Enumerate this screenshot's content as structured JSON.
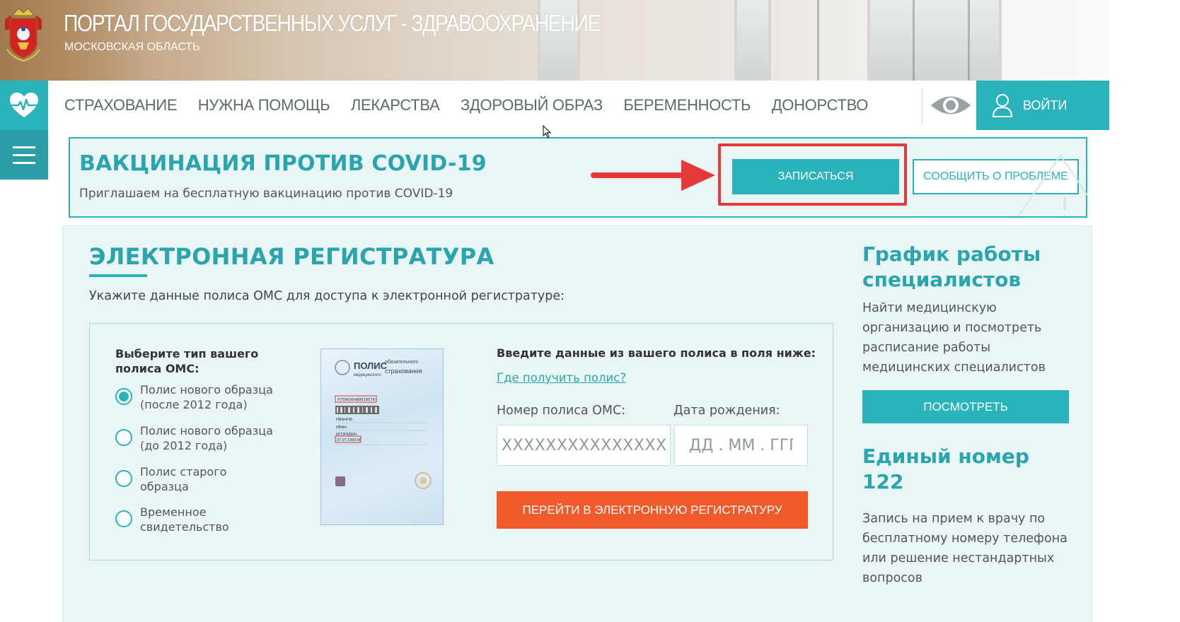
{
  "header": {
    "title": "ПОРТАЛ ГОСУДАРСТВЕННЫХ УСЛУГ - ЗДРАВООХРАНЕНИЕ",
    "subtitle": "МОСКОВСКАЯ ОБЛАСТЬ",
    "logo_icon": "coat-of-arms-icon"
  },
  "nav": {
    "items": [
      "СТРАХОВАНИЕ",
      "НУЖНА ПОМОЩЬ",
      "ЛЕКАРСТВА",
      "ЗДОРОВЫЙ ОБРАЗ",
      "БЕРЕМЕННОСТЬ",
      "ДОНОРСТВО"
    ],
    "health_icon": "heart-pulse-icon",
    "accessibility_icon": "eye-icon",
    "login_label": "ВОЙТИ",
    "menu_icon": "hamburger-icon"
  },
  "covid_banner": {
    "title": "ВАКЦИНАЦИЯ ПРОТИВ COVID-19",
    "text": "Приглашаем на бесплатную вакцинацию против COVID-19",
    "signup_label": "ЗАПИСАТЬСЯ",
    "report_label": "СООБЩИТЬ О ПРОБЛЕМЕ"
  },
  "registry": {
    "title": "ЭЛЕКТРОННАЯ РЕГИСТРАТУРА",
    "description": "Укажите данные полиса ОМС для доступа к электронной регистратуре:",
    "type_title": "Выберите тип вашего полиса ОМС:",
    "options": [
      {
        "label": "Полис нового образца (после 2012 года)",
        "selected": true
      },
      {
        "label": "Полис нового образца (до 2012 года)",
        "selected": false
      },
      {
        "label": "Полис старого образца",
        "selected": false
      },
      {
        "label": "Временное свидетельство",
        "selected": false
      }
    ],
    "card": {
      "title": "ПОЛИС",
      "subtitle": "обязательного медицинского страхования",
      "number": "0750036480010570",
      "surname": "ИВАНОВ",
      "name": "ИВАН",
      "patronymic": "ИГОРЕВИЧ",
      "dob": "27.07.1993 М"
    },
    "enter_title": "Введите данные из вашего полиса в поля ниже:",
    "where_link": "Где получить полис?",
    "policy_label": "Номер полиса ОМС:",
    "policy_placeholder": "XXXXXXXXXXXXXXXX",
    "dob_label": "Дата рождения:",
    "dob_placeholder": "ДД . ММ . ГГГГ",
    "go_button": "ПЕРЕЙТИ В ЭЛЕКТРОННУЮ РЕГИСТРАТУРУ"
  },
  "sidebar": {
    "schedule_title": "График работы специалистов",
    "schedule_text": "Найти медицинскую организацию и посмотреть расписание работы медицинских специалистов",
    "view_button": "ПОСМОТРЕТЬ",
    "hotline_title": "Единый номер 122",
    "hotline_text": "Запись на прием к врачу по бесплатному номеру телефона или решение нестандартных вопросов"
  },
  "colors": {
    "accent": "#2bb3bb",
    "orange": "#f15a2b",
    "highlight": "#e5393a",
    "panel_bg": "#eaf6f6"
  }
}
